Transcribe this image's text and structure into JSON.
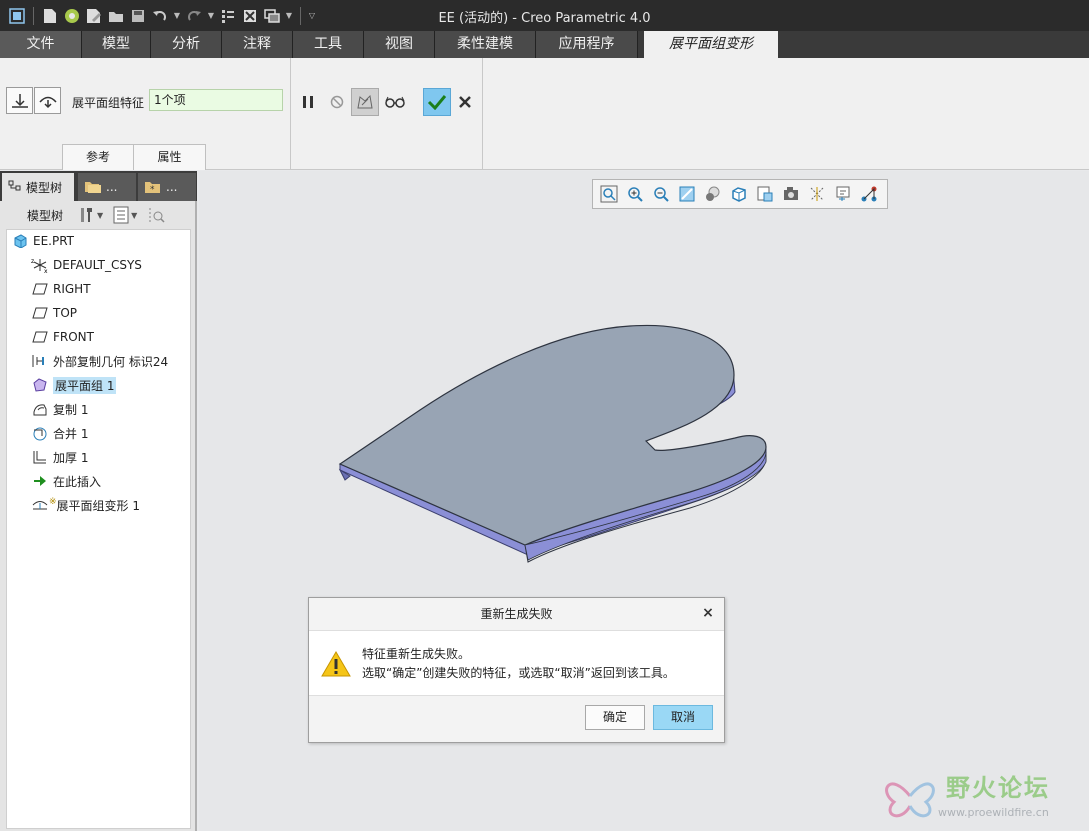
{
  "window": {
    "title": "EE (活动的) - Creo Parametric 4.0"
  },
  "ribbon_tabs": [
    {
      "label": "文件"
    },
    {
      "label": "模型"
    },
    {
      "label": "分析"
    },
    {
      "label": "注释"
    },
    {
      "label": "工具"
    },
    {
      "label": "视图"
    },
    {
      "label": "柔性建模"
    },
    {
      "label": "应用程序"
    },
    {
      "label": "展平面组变形"
    }
  ],
  "ribbon": {
    "feature_label": "展平面组特征",
    "feature_value": "1个项",
    "subtabs": [
      "参考",
      "属性"
    ]
  },
  "panel": {
    "tabs": [
      "模型树",
      "...",
      "..."
    ],
    "toolbar_label": "模型树"
  },
  "tree": {
    "items": [
      {
        "label": "EE.PRT",
        "icon": "part-icon"
      },
      {
        "label": "DEFAULT_CSYS",
        "icon": "csys-icon"
      },
      {
        "label": "RIGHT",
        "icon": "datum-plane-icon"
      },
      {
        "label": "TOP",
        "icon": "datum-plane-icon"
      },
      {
        "label": "FRONT",
        "icon": "datum-plane-icon"
      },
      {
        "label": "外部复制几何 标识24",
        "icon": "external-copy-geom-icon"
      },
      {
        "label": "展平面组 1",
        "icon": "flatten-quilt-icon",
        "selected": true
      },
      {
        "label": "复制 1",
        "icon": "copy-surface-icon"
      },
      {
        "label": "合并 1",
        "icon": "merge-icon"
      },
      {
        "label": "加厚 1",
        "icon": "thicken-icon"
      },
      {
        "label": "在此插入",
        "icon": "insert-here-arrow-icon"
      },
      {
        "label": "展平面组变形 1",
        "icon": "flatten-deform-icon",
        "marker": "※"
      }
    ]
  },
  "dialog": {
    "title": "重新生成失败",
    "message_line1": "特征重新生成失败。",
    "message_line2": "选取“确定”创建失败的特征，或选取“取消”返回到该工具。",
    "ok_label": "确定",
    "cancel_label": "取消"
  },
  "watermark": {
    "name": "野火论坛",
    "url": "www.proewildfire.cn"
  },
  "colors": {
    "title_bar": "#2b2b2b",
    "ribbon_bg": "#f0f0f0",
    "accent_ok": "#7fc7ef",
    "collector_bg": "#eafbe3",
    "part_top": "#98a4b4",
    "part_edge": "#8b8fd6"
  }
}
